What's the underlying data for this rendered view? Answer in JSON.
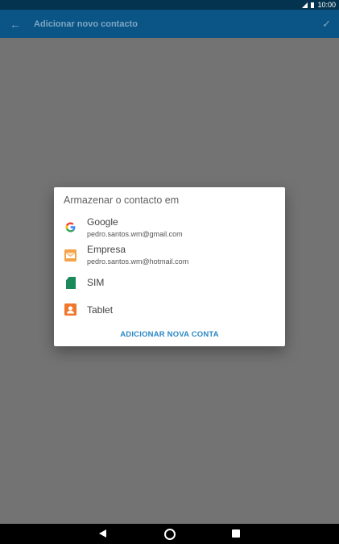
{
  "status_bar": {
    "time": "10:00"
  },
  "app_bar": {
    "title": "Adicionar novo contacto",
    "back_icon": "arrow-back-icon",
    "confirm_icon": "check-icon"
  },
  "dialog": {
    "title": "Armazenar o contacto em",
    "accounts": [
      {
        "icon": "google-icon",
        "name": "Google",
        "email": "pedro.santos.wm@gmail.com"
      },
      {
        "icon": "email-icon",
        "name": "Empresa",
        "email": "pedro.santos.wm@hotmail.com"
      },
      {
        "icon": "sim-card-icon",
        "name": "SIM",
        "email": ""
      },
      {
        "icon": "tablet-contacts-icon",
        "name": "Tablet",
        "email": ""
      }
    ],
    "add_account_label": "ADICIONAR NOVA CONTA"
  },
  "navigation": {
    "back_icon": "nav-back-icon",
    "home_icon": "nav-home-icon",
    "recents_icon": "nav-recents-icon"
  },
  "colors": {
    "status_bar": "#03334f",
    "app_bar": "#0a5586",
    "scrim": "#737373",
    "accent": "#2a88c4"
  }
}
